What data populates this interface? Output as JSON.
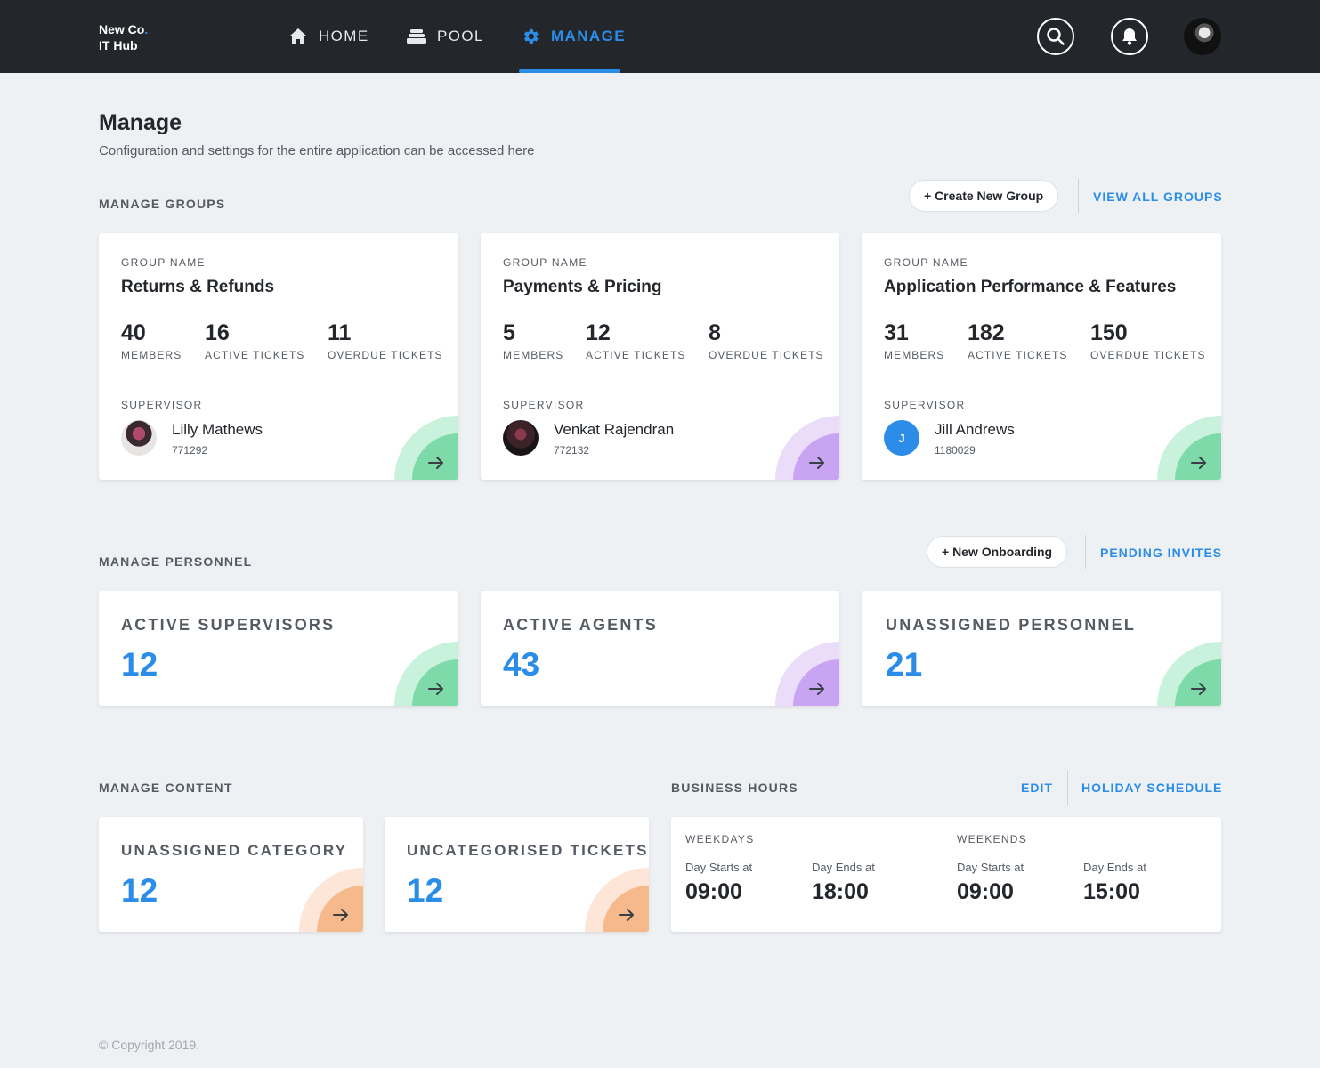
{
  "brand": {
    "line1": "New Co",
    "dot": ".",
    "line2": "IT Hub"
  },
  "nav": [
    {
      "label": "HOME",
      "icon": "home-icon"
    },
    {
      "label": "POOL",
      "icon": "pool-icon"
    },
    {
      "label": "MANAGE",
      "icon": "gear-icon",
      "active": true
    }
  ],
  "header_actions": {
    "search_icon": "search-icon",
    "bell_icon": "bell-icon",
    "avatar": "user-avatar"
  },
  "page": {
    "title": "Manage",
    "subtitle": "Configuration and settings for the entire application can be accessed here"
  },
  "groups": {
    "section_label": "MANAGE GROUPS",
    "create_label": "+ Create New Group",
    "view_all_label": "VIEW ALL GROUPS",
    "cards": [
      {
        "group_label": "GROUP NAME",
        "name": "Returns & Refunds",
        "members": "40",
        "members_label": "MEMBERS",
        "active": "16",
        "active_label": "ACTIVE TICKETS",
        "overdue": "11",
        "overdue_label": "OVERDUE TICKETS",
        "supervisor_label": "SUPERVISOR",
        "supervisor": "Lilly Mathews",
        "supervisor_id": "771292",
        "accent": "green"
      },
      {
        "group_label": "GROUP NAME",
        "name": "Payments & Pricing",
        "members": "5",
        "members_label": "MEMBERS",
        "active": "12",
        "active_label": "ACTIVE TICKETS",
        "overdue": "8",
        "overdue_label": "OVERDUE TICKETS",
        "supervisor_label": "SUPERVISOR",
        "supervisor": "Venkat Rajendran",
        "supervisor_id": "772132",
        "accent": "purple"
      },
      {
        "group_label": "GROUP NAME",
        "name": "Application Performance & Features",
        "members": "31",
        "members_label": "MEMBERS",
        "active": "182",
        "active_label": "ACTIVE TICKETS",
        "overdue": "150",
        "overdue_label": "OVERDUE TICKETS",
        "supervisor_label": "SUPERVISOR",
        "supervisor": "Jill Andrews",
        "supervisor_id": "1180029",
        "supervisor_initial": "J",
        "accent": "green"
      }
    ]
  },
  "personnel": {
    "section_label": "MANAGE PERSONNEL",
    "onboarding_label": "+ New Onboarding",
    "pending_label": "PENDING INVITES",
    "cards": [
      {
        "label": "ACTIVE SUPERVISORS",
        "value": "12",
        "accent": "green"
      },
      {
        "label": "ACTIVE AGENTS",
        "value": "43",
        "accent": "purple"
      },
      {
        "label": "UNASSIGNED PERSONNEL",
        "value": "21",
        "accent": "green"
      }
    ]
  },
  "content": {
    "section_label": "MANAGE CONTENT",
    "cards": [
      {
        "label": "UNASSIGNED CATEGORY",
        "value": "12",
        "accent": "orange"
      },
      {
        "label": "UNCATEGORISED TICKETS",
        "value": "12",
        "accent": "orange"
      }
    ]
  },
  "business_hours": {
    "section_label": "BUSINESS HOURS",
    "edit_label": "EDIT",
    "holiday_label": "HOLIDAY SCHEDULE",
    "weekdays": {
      "label": "WEEKDAYS",
      "start_label": "Day Starts at",
      "start": "09:00",
      "end_label": "Day Ends at",
      "end": "18:00"
    },
    "weekends": {
      "label": "WEEKENDS",
      "start_label": "Day Starts at",
      "start": "09:00",
      "end_label": "Day Ends at",
      "end": "15:00"
    }
  },
  "footer": {
    "copyright": "© Copyright 2019."
  },
  "colors": {
    "accent": "#2b8de8",
    "topbar": "#23262b",
    "background": "#eef1f4"
  }
}
